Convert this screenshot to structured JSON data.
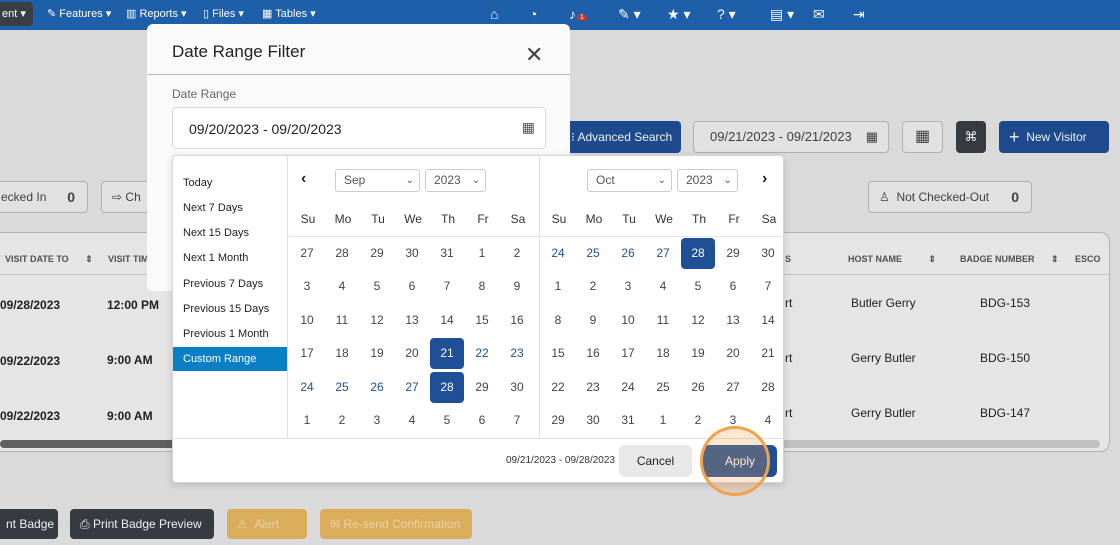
{
  "navbar": {
    "agent_label": "ent",
    "features": "Features",
    "reports": "Reports",
    "files": "Files",
    "tables": "Tables",
    "notif_count": "1"
  },
  "bg": {
    "advanced_search": "Advanced Search",
    "top_date_range": "09/21/2023 - 09/21/2023",
    "new_visitor": "New Visitor",
    "checked_in_label": "ecked In",
    "checked_in_count": "0",
    "ch_label": "Ch",
    "not_checked_out_label": "Not Checked-Out",
    "not_checked_out_count": "0",
    "columns": [
      "VISIT DATE TO",
      "VISIT TIM",
      "S",
      "HOST NAME",
      "BADGE NUMBER",
      "ESCO"
    ],
    "rows": [
      {
        "date": "09/28/2023",
        "time": "12:00 PM",
        "s": "rt",
        "host": "Butler Gerry",
        "badge": "BDG-153"
      },
      {
        "date": "09/22/2023",
        "time": "9:00 AM",
        "s": "rt",
        "host": "Gerry Butler",
        "badge": "BDG-150"
      },
      {
        "date": "09/22/2023",
        "time": "9:00 AM",
        "s": "rt",
        "host": "Gerry Butler",
        "badge": "BDG-147"
      }
    ],
    "bottom_buttons": [
      "nt Badge",
      "Print Badge Preview",
      "Alert",
      "Re-send Confirmation"
    ]
  },
  "modal": {
    "title": "Date Range Filter",
    "date_range_label": "Date Range",
    "date_range_value": "09/20/2023 - 09/20/2023"
  },
  "picker": {
    "ranges": [
      "Today",
      "Next 7 Days",
      "Next 15 Days",
      "Next 1 Month",
      "Previous 7 Days",
      "Previous 15 Days",
      "Previous 1 Month",
      "Custom Range"
    ],
    "active_range": "Custom Range",
    "weekdays": [
      "Su",
      "Mo",
      "Tu",
      "We",
      "Th",
      "Fr",
      "Sa"
    ],
    "left": {
      "month": "Sep",
      "year": "2023",
      "weeks": [
        [
          "27",
          "28",
          "29",
          "30",
          "31",
          "1",
          "2"
        ],
        [
          "3",
          "4",
          "5",
          "6",
          "7",
          "8",
          "9"
        ],
        [
          "10",
          "11",
          "12",
          "13",
          "14",
          "15",
          "16"
        ],
        [
          "17",
          "18",
          "19",
          "20",
          "21",
          "22",
          "23"
        ],
        [
          "24",
          "25",
          "26",
          "27",
          "28",
          "29",
          "30"
        ],
        [
          "1",
          "2",
          "3",
          "4",
          "5",
          "6",
          "7"
        ]
      ]
    },
    "right": {
      "month": "Oct",
      "year": "2023",
      "weeks": [
        [
          "24",
          "25",
          "26",
          "27",
          "28",
          "29",
          "30"
        ],
        [
          "1",
          "2",
          "3",
          "4",
          "5",
          "6",
          "7"
        ],
        [
          "8",
          "9",
          "10",
          "11",
          "12",
          "13",
          "14"
        ],
        [
          "15",
          "16",
          "17",
          "18",
          "19",
          "20",
          "21"
        ],
        [
          "22",
          "23",
          "24",
          "25",
          "26",
          "27",
          "28"
        ],
        [
          "29",
          "30",
          "31",
          "1",
          "2",
          "3",
          "4"
        ]
      ]
    },
    "selected_range": "09/21/2023 - 09/28/2023",
    "cancel": "Cancel",
    "apply": "Apply"
  }
}
